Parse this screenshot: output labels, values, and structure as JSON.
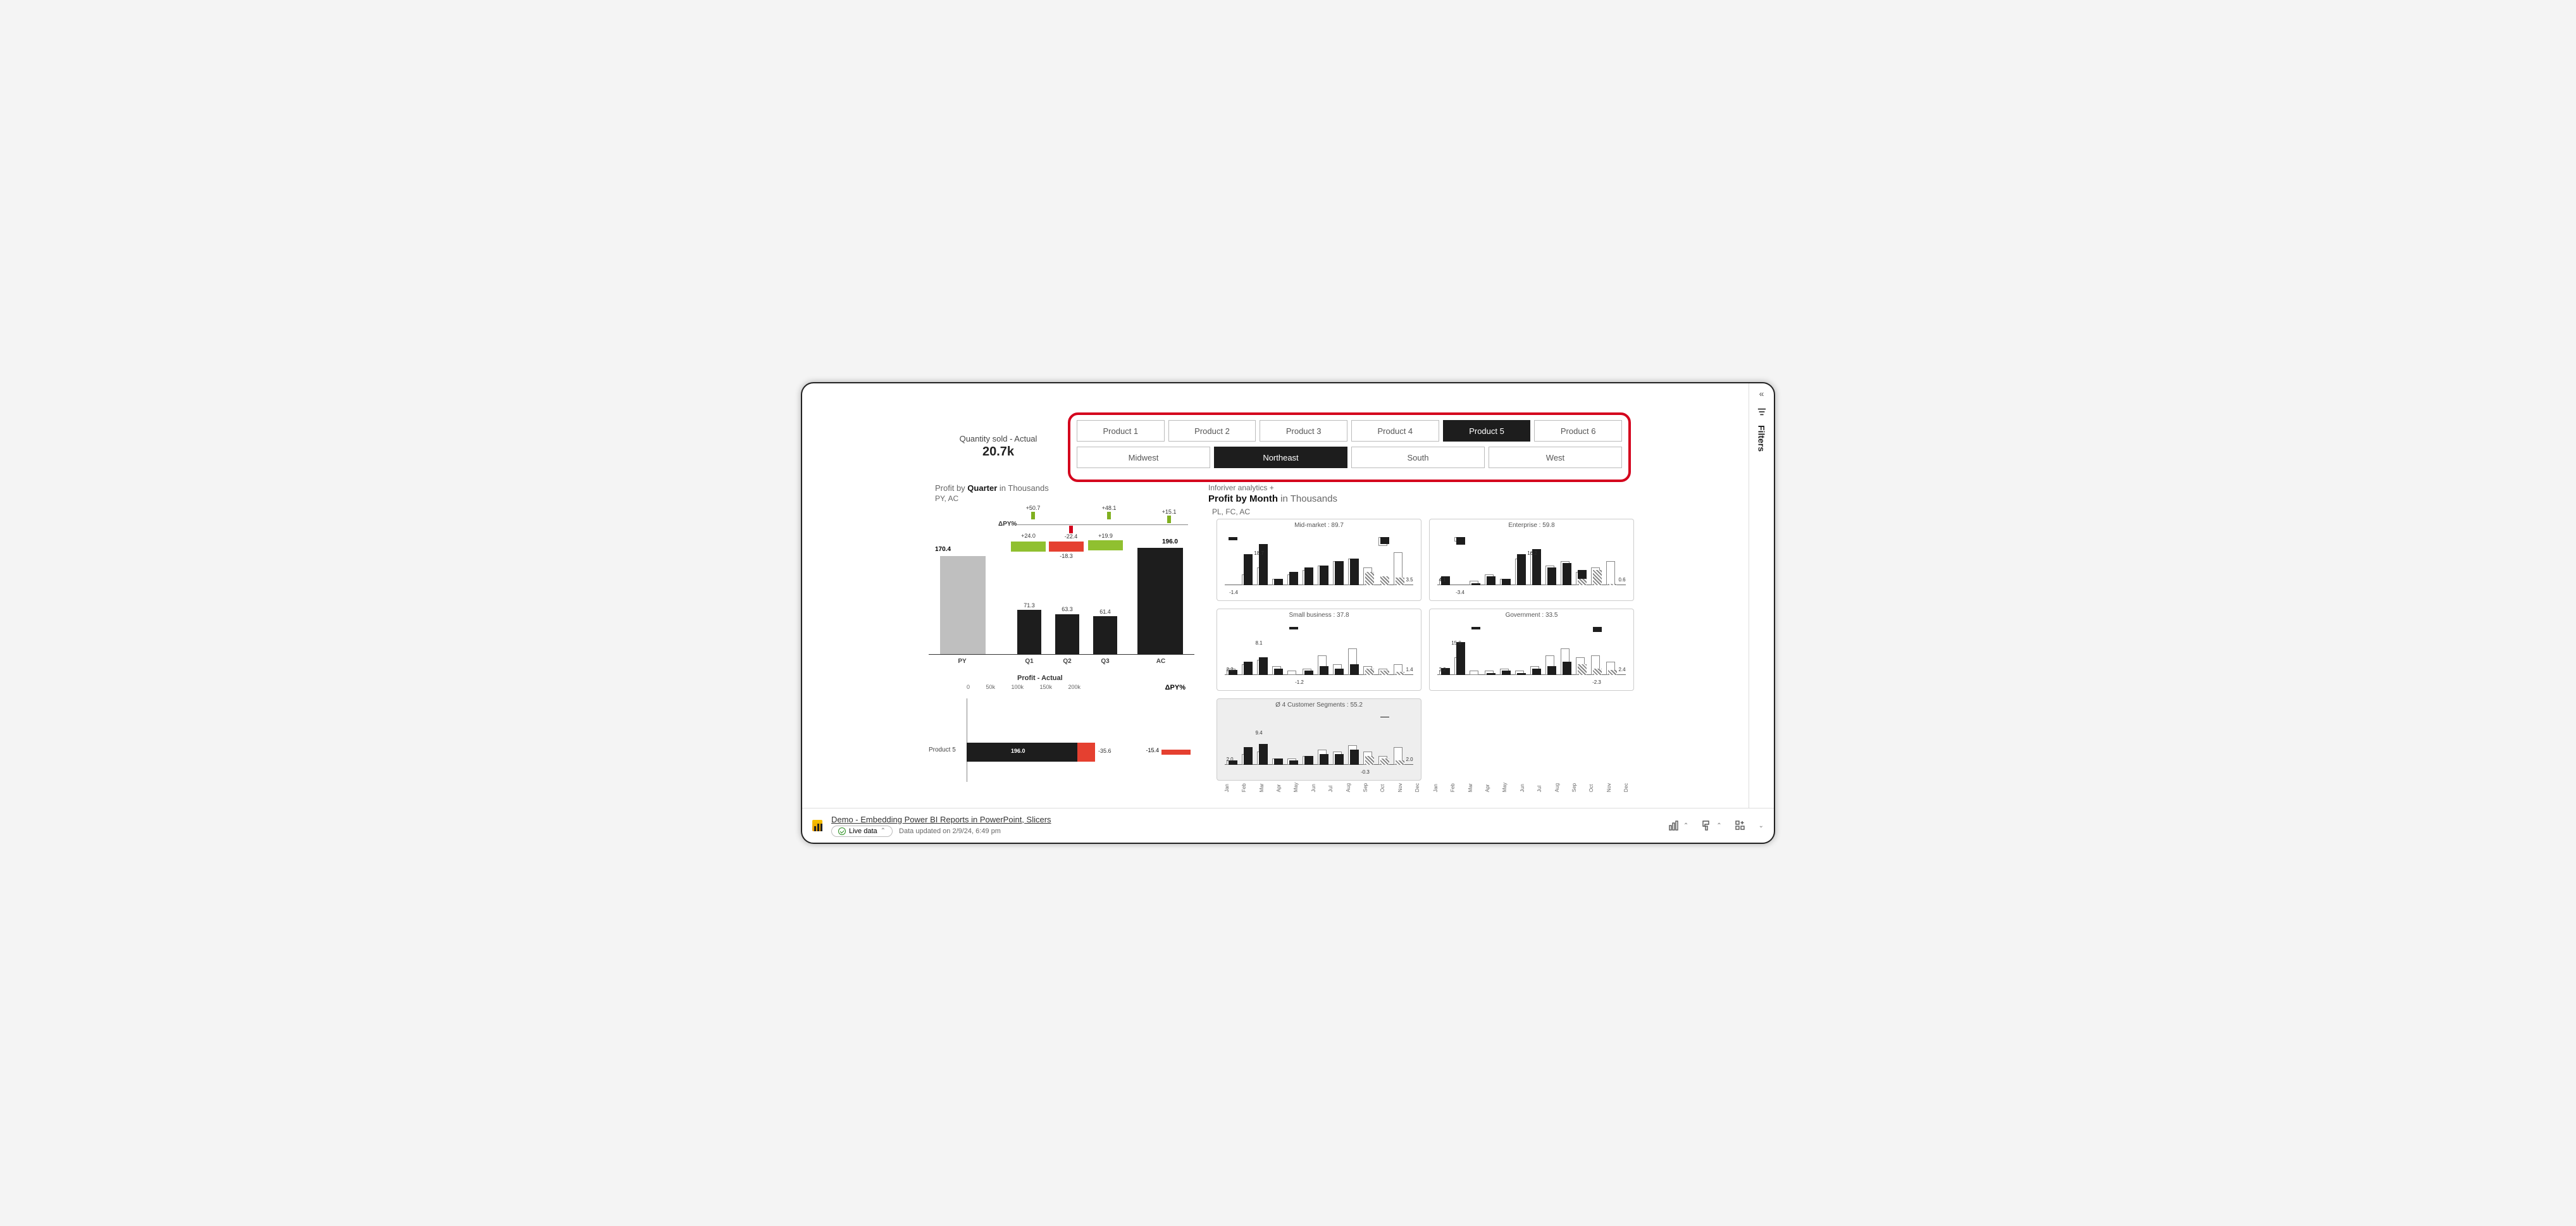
{
  "kpi": {
    "title": "Quantity sold - Actual",
    "value": "20.7k"
  },
  "slicers": {
    "products": [
      "Product 1",
      "Product 2",
      "Product 3",
      "Product 4",
      "Product 5",
      "Product 6"
    ],
    "product_active": 4,
    "regions": [
      "Midwest",
      "Northeast",
      "South",
      "West"
    ],
    "region_active": 1
  },
  "quarter_chart": {
    "title_prefix": "Profit by ",
    "title_bold": "Quarter",
    "title_suffix": "  in Thousands",
    "sub": "PY,  AC",
    "dpy_label": "ΔPY%",
    "deltas": [
      {
        "label": "+50.7",
        "color": "green"
      },
      {
        "label": "-22.4",
        "color": "red"
      },
      {
        "label": "+48.1",
        "color": "green"
      },
      {
        "label": "+15.1",
        "color": "green"
      }
    ],
    "py": {
      "label": "PY",
      "value": "170.4"
    },
    "ac": {
      "label": "AC",
      "value": "196.0"
    },
    "quarters": [
      {
        "label": "Q1",
        "value": "71.3",
        "bridge": "+24.0",
        "bridge_color": "green"
      },
      {
        "label": "Q2",
        "value": "63.3",
        "bridge": "-18.3",
        "bridge_color": "red"
      },
      {
        "label": "Q3",
        "value": "61.4",
        "bridge": "+19.9",
        "bridge_color": "green"
      }
    ]
  },
  "profit_chart": {
    "title": "Profit - Actual",
    "ticks": [
      "0",
      "50k",
      "100k",
      "150k",
      "200k"
    ],
    "dpy_label": "ΔPY%",
    "row_label": "Product 5",
    "value": "196.0",
    "neg": "-35.6",
    "dpy": "-15.4"
  },
  "month_chart": {
    "inforiver": "Inforiver analytics +",
    "title_prefix": "Profit by ",
    "title_bold": "Month",
    "title_suffix": "  in Thousands",
    "sub": "PL,  FC,  AC",
    "months": [
      "Jan",
      "Feb",
      "Mar",
      "Apr",
      "May",
      "Jun",
      "Jul",
      "Aug",
      "Sep",
      "Oct",
      "Nov",
      "Dec"
    ],
    "panels": [
      {
        "name": "Mid-market",
        "total": "89.7",
        "label_lo": "-1.4",
        "label_hi": "18.7",
        "label_last": "3.5"
      },
      {
        "name": "Enterprise",
        "total": "59.8",
        "label_lo": "-3.4",
        "label_hi": "16.2",
        "label_first": "4.1",
        "label_last": "0.6"
      },
      {
        "name": "Small business",
        "total": "37.8",
        "label_lo": "-1.2",
        "label_hi": "8.1",
        "label_first": "2.2",
        "label_last": "1.4"
      },
      {
        "name": "Government",
        "total": "33.5",
        "label_lo": "-2.3",
        "label_hi": "15.0",
        "label_first": "3.2",
        "label_last": "2.4"
      },
      {
        "name": "Ø 4 Customer Segments",
        "total": "55.2",
        "label_lo": "-0.3",
        "label_hi": "9.4",
        "label_first": "2.0",
        "label_last": "2.0",
        "summary": true
      }
    ]
  },
  "chart_data": {
    "waterfall": {
      "type": "bar",
      "title": "Profit by Quarter in Thousands — PY vs AC",
      "categories": [
        "PY",
        "Q1",
        "Q2",
        "Q3",
        "AC"
      ],
      "values": [
        170.4,
        71.3,
        63.3,
        61.4,
        196.0
      ],
      "bridge_deltas": {
        "Q1": 24.0,
        "Q2": -18.3,
        "Q3": 19.9
      },
      "delta_py_pct": {
        "Q1": 50.7,
        "Q2": -22.4,
        "Q3": 48.1,
        "AC": 15.1
      }
    },
    "profit_actual": {
      "type": "bar",
      "title": "Profit - Actual",
      "xlabel": "",
      "ylabel": "",
      "xlim": [
        0,
        200000
      ],
      "series": [
        {
          "name": "Product 5",
          "ac": 196000,
          "fc_overrun": -35600,
          "delta_py_pct": -15.4
        }
      ]
    },
    "profit_by_month": {
      "type": "bar",
      "title": "Profit by Month in Thousands — PL, FC, AC",
      "x": [
        "Jan",
        "Feb",
        "Mar",
        "Apr",
        "May",
        "Jun",
        "Jul",
        "Aug",
        "Sep",
        "Oct",
        "Nov",
        "Dec"
      ],
      "panels": {
        "Mid-market": {
          "total": 89.7,
          "ac": [
            -1.4,
            14,
            18.7,
            3,
            6,
            8,
            9,
            11,
            12,
            2,
            -3,
            0
          ],
          "fc": [
            0,
            0,
            0,
            0,
            0,
            0,
            0,
            0,
            0,
            6,
            4,
            3.5
          ],
          "pl": [
            0,
            5,
            8,
            3,
            5,
            7,
            9,
            11,
            12,
            8,
            -4,
            15
          ]
        },
        "Enterprise": {
          "total": 59.8,
          "ac": [
            4.1,
            -3.4,
            1,
            4,
            3,
            14,
            16.2,
            8,
            10,
            7,
            2,
            0
          ],
          "fc": [
            0,
            0,
            0,
            0,
            0,
            0,
            0,
            0,
            0,
            3,
            7,
            0.6
          ],
          "pl": [
            3,
            -2,
            2,
            5,
            3,
            12,
            15,
            9,
            11,
            6,
            8,
            11
          ]
        },
        "Small business": {
          "total": 37.8,
          "ac": [
            2.2,
            6,
            8.1,
            3,
            -1.2,
            2,
            4,
            3,
            5,
            0,
            0,
            0
          ],
          "fc": [
            0,
            0,
            0,
            0,
            0,
            0,
            0,
            0,
            0,
            3,
            2,
            1.4
          ],
          "pl": [
            3,
            5,
            7,
            4,
            2,
            3,
            9,
            5,
            12,
            4,
            3,
            5
          ]
        },
        "Government": {
          "total": 33.5,
          "ac": [
            3.2,
            15.0,
            -1,
            1,
            2,
            1,
            3,
            4,
            6,
            0,
            -2.3,
            0
          ],
          "fc": [
            0,
            0,
            0,
            0,
            0,
            0,
            0,
            0,
            0,
            5,
            3,
            2.4
          ],
          "pl": [
            2,
            8,
            2,
            2,
            3,
            2,
            4,
            9,
            12,
            8,
            9,
            6
          ]
        },
        "Avg 4 Segments": {
          "total": 55.2,
          "ac": [
            2.0,
            8,
            9.4,
            3,
            2,
            4,
            5,
            5,
            7,
            0,
            -0.3,
            0
          ],
          "fc": [
            0,
            0,
            0,
            0,
            0,
            0,
            0,
            0,
            0,
            4,
            3,
            2.0
          ],
          "pl": [
            2,
            5,
            6,
            3,
            3,
            4,
            7,
            6,
            9,
            6,
            4,
            8
          ]
        }
      }
    }
  },
  "footer": {
    "title": "Demo - Embedding Power BI Reports in PowerPoint, Slicers",
    "live": "Live data",
    "updated": "Data updated on 2/9/24, 6:49 pm"
  },
  "filters_label": "Filters"
}
